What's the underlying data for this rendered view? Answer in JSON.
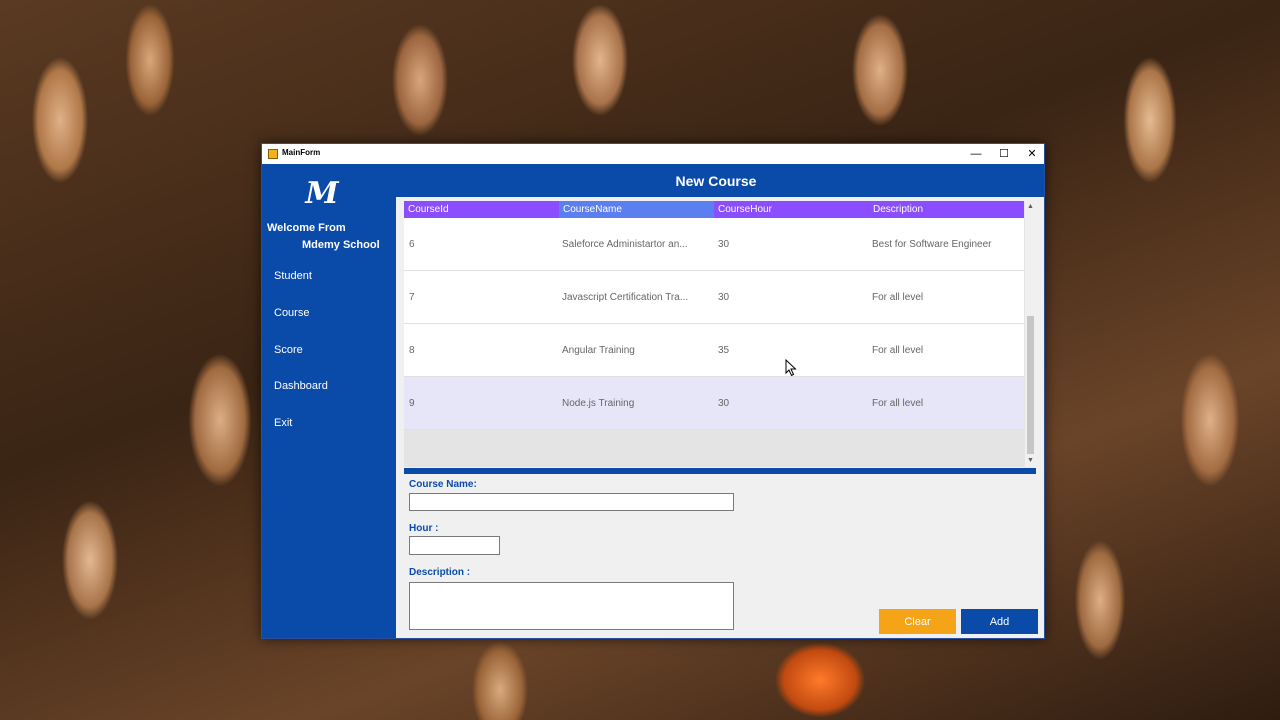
{
  "window": {
    "title": "MainForm",
    "minimize_glyph": "—",
    "maximize_glyph": "☐",
    "close_glyph": "✕"
  },
  "sidebar": {
    "logo": "M",
    "welcome_line1": "Welcome From",
    "welcome_line2": "Mdemy School",
    "items": [
      {
        "label": "Student"
      },
      {
        "label": "Course"
      },
      {
        "label": "Score"
      },
      {
        "label": "Dashboard"
      },
      {
        "label": "Exit"
      }
    ]
  },
  "header": {
    "title": "New Course"
  },
  "grid": {
    "columns": [
      "CourseId",
      "CourseName",
      "CourseHour",
      "Description"
    ],
    "rows": [
      {
        "id": "6",
        "name": "Saleforce Administartor an...",
        "hour": "30",
        "description": "Best for Software Engineer"
      },
      {
        "id": "7",
        "name": "Javascript Certification Tra...",
        "hour": "30",
        "description": "For all level"
      },
      {
        "id": "8",
        "name": "Angular Training",
        "hour": "35",
        "description": "For all level"
      },
      {
        "id": "9",
        "name": "Node.js Training",
        "hour": "30",
        "description": "For all level"
      }
    ],
    "scroll_up_glyph": "▲",
    "scroll_down_glyph": "▼"
  },
  "form": {
    "course_name_label": "Course Name:",
    "course_name_value": "",
    "hour_label": "Hour :",
    "hour_value": "",
    "description_label": "Description :",
    "description_value": ""
  },
  "buttons": {
    "clear": "Clear",
    "add": "Add"
  },
  "colors": {
    "brand_blue": "#0a4aa8",
    "grid_header": "#8a4dff",
    "clear_button": "#f5a418"
  }
}
